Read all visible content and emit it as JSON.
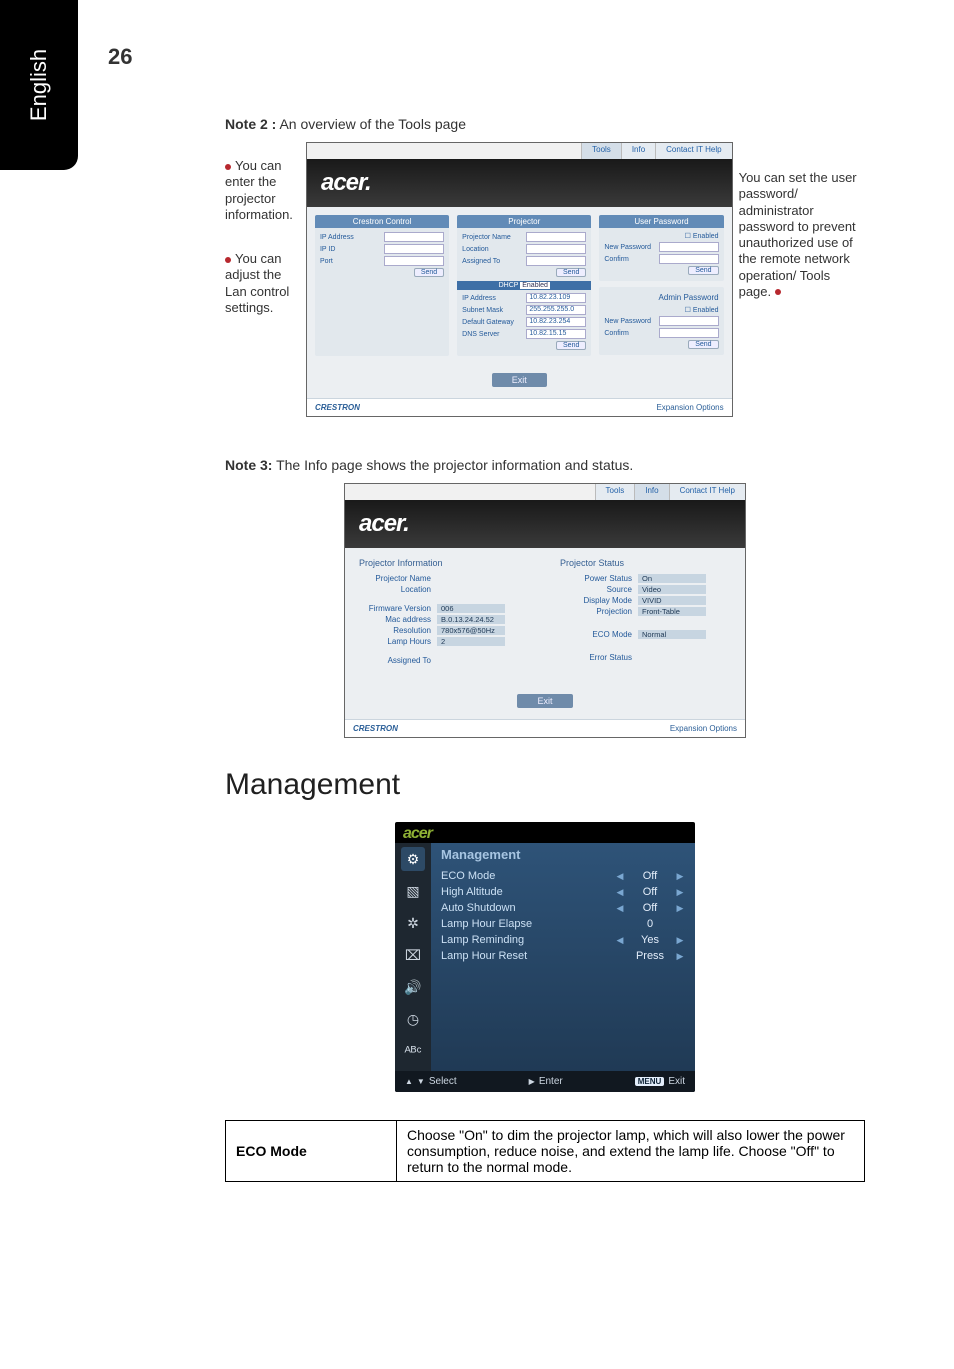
{
  "page_number": "26",
  "side_tab": "English",
  "note2_title_bold": "Note 2 :",
  "note2_title_rest": " An overview of the Tools page",
  "annotations_left": {
    "a1": "You can enter the projector information.",
    "a2": "You can adjust the Lan control settings."
  },
  "annotations_right": {
    "r1": "You can set the user password/ administrator password to prevent unauthorized use of the remote network operation/ Tools page."
  },
  "tools": {
    "tabs": [
      "Tools",
      "Info",
      "Contact IT Help"
    ],
    "exit": "Exit",
    "footer_left": "CRESTRON",
    "footer_right": "Expansion Options",
    "col_crestron": {
      "title": "Crestron Control",
      "rows": [
        {
          "lbl": "IP Address",
          "val": ""
        },
        {
          "lbl": "IP ID",
          "val": ""
        },
        {
          "lbl": "Port",
          "val": ""
        }
      ],
      "btn": "Send"
    },
    "col_projector": {
      "title": "Projector",
      "rows_top": [
        {
          "lbl": "Projector Name",
          "val": ""
        },
        {
          "lbl": "Location",
          "val": ""
        },
        {
          "lbl": "Assigned To",
          "val": ""
        }
      ],
      "btn_top": "Send",
      "dhcp_label": "DHCP",
      "dhcp_state": "Enabled",
      "rows_net": [
        {
          "lbl": "IP Address",
          "val": "10.82.23.109"
        },
        {
          "lbl": "Subnet Mask",
          "val": "255.255.255.0"
        },
        {
          "lbl": "Default Gateway",
          "val": "10.82.23.254"
        },
        {
          "lbl": "DNS Server",
          "val": "10.82.15.15"
        }
      ],
      "btn_net": "Send"
    },
    "col_user": {
      "title": "User Password",
      "enabled": "Enabled",
      "rows": [
        {
          "lbl": "New Password",
          "val": ""
        },
        {
          "lbl": "Confirm",
          "val": ""
        }
      ],
      "btn": "Send"
    },
    "col_admin": {
      "title": "Admin Password",
      "enabled": "Enabled",
      "rows": [
        {
          "lbl": "New Password",
          "val": ""
        },
        {
          "lbl": "Confirm",
          "val": ""
        }
      ],
      "btn": "Send"
    }
  },
  "note3_title_bold": "Note 3:",
  "note3_title_rest": " The Info page shows the projector information and status.",
  "info": {
    "tabs": [
      "Tools",
      "Info",
      "Contact IT Help"
    ],
    "left_title": "Projector Information",
    "right_title": "Projector Status",
    "left_rows": [
      {
        "lbl": "Projector Name",
        "val": ""
      },
      {
        "lbl": "Location",
        "val": ""
      },
      {
        "lbl": "Firmware Version",
        "val": "006"
      },
      {
        "lbl": "Mac address",
        "val": "B.0.13.24.24.52"
      },
      {
        "lbl": "Resolution",
        "val": "780x576@50Hz"
      },
      {
        "lbl": "Lamp Hours",
        "val": "2"
      },
      {
        "lbl": "Assigned To",
        "val": ""
      }
    ],
    "right_rows": [
      {
        "lbl": "Power Status",
        "val": "On"
      },
      {
        "lbl": "Source",
        "val": "Video"
      },
      {
        "lbl": "Display Mode",
        "val": "VIVID"
      },
      {
        "lbl": "Projection",
        "val": "Front-Table"
      },
      {
        "lbl": "ECO Mode",
        "val": "Normal"
      },
      {
        "lbl": "Error Status",
        "val": ""
      }
    ],
    "exit": "Exit",
    "footer_left": "CRESTRON",
    "footer_right": "Expansion Options"
  },
  "mgmt_heading": "Management",
  "mgmt_menu": {
    "title": "Management",
    "rows": [
      {
        "lbl": "ECO Mode",
        "val": "Off",
        "left_arrow": true,
        "right_arrow": true
      },
      {
        "lbl": "High Altitude",
        "val": "Off",
        "left_arrow": true,
        "right_arrow": true
      },
      {
        "lbl": "Auto Shutdown",
        "val": "Off",
        "left_arrow": true,
        "right_arrow": true
      },
      {
        "lbl": "Lamp Hour Elapse",
        "val": "0",
        "left_arrow": false,
        "right_arrow": false
      },
      {
        "lbl": "Lamp Reminding",
        "val": "Yes",
        "left_arrow": true,
        "right_arrow": true
      },
      {
        "lbl": "Lamp Hour Reset",
        "val": "Press",
        "left_arrow": false,
        "right_arrow": true
      }
    ],
    "footer": {
      "select": "Select",
      "enter": "Enter",
      "exit_tag": "MENU",
      "exit_text": "Exit"
    }
  },
  "eco_table": {
    "label": "ECO Mode",
    "desc": "Choose \"On\" to dim the projector lamp, which will also lower the power consumption, reduce noise, and extend the lamp life. Choose \"Off\" to return to the normal mode."
  }
}
